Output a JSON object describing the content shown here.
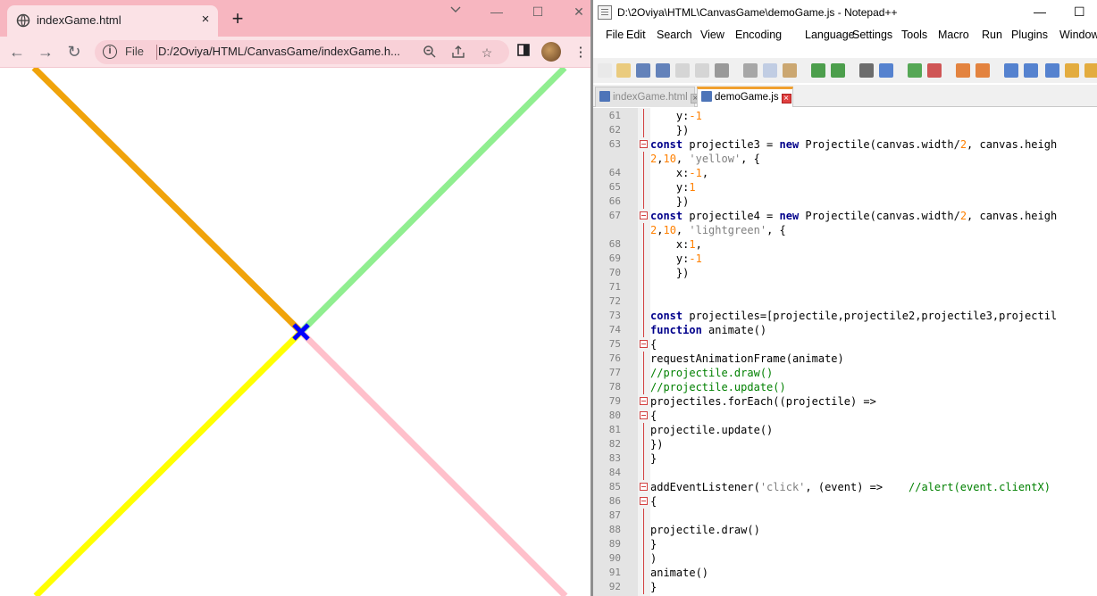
{
  "chrome": {
    "tab_title": "indexGame.html",
    "tab_close": "×",
    "new_tab": "+",
    "win_minimize": "—",
    "win_maximize": "☐",
    "win_close": "✕",
    "scheme": "File",
    "url": "D:/2Oviya/HTML/CanvasGame/indexGame.h..."
  },
  "canvas_colors": {
    "top_left": "#f0a30a",
    "top_right": "#90ee90",
    "bottom_left": "#ffff00",
    "bottom_right": "#ffc0cb",
    "player": "#0000ff"
  },
  "npp": {
    "title": "D:\\2Oviya\\HTML\\CanvasGame\\demoGame.js - Notepad++",
    "win_minimize": "—",
    "win_maximize": "☐",
    "menu": [
      "File",
      "Edit",
      "Search",
      "View",
      "Encoding",
      "Language",
      "Settings",
      "Tools",
      "Macro",
      "Run",
      "Plugins",
      "Window"
    ],
    "tabs": [
      {
        "label": "indexGame.html",
        "active": false
      },
      {
        "label": "demoGame.js",
        "active": true
      }
    ],
    "lines": [
      {
        "n": "61",
        "text": "    y:-1"
      },
      {
        "n": "62",
        "text": "    })"
      },
      {
        "n": "63",
        "text": "const projectile3 = new Projectile(canvas.width/2, canvas.heigh"
      },
      {
        "n": "",
        "text": "2,10, 'yellow', {"
      },
      {
        "n": "64",
        "text": "    x:-1,"
      },
      {
        "n": "65",
        "text": "    y:1"
      },
      {
        "n": "66",
        "text": "    })"
      },
      {
        "n": "67",
        "text": "const projectile4 = new Projectile(canvas.width/2, canvas.heigh"
      },
      {
        "n": "",
        "text": "2,10, 'lightgreen', {"
      },
      {
        "n": "68",
        "text": "    x:1,"
      },
      {
        "n": "69",
        "text": "    y:-1"
      },
      {
        "n": "70",
        "text": "    })"
      },
      {
        "n": "71",
        "text": ""
      },
      {
        "n": "72",
        "text": ""
      },
      {
        "n": "73",
        "text": "const projectiles=[projectile,projectile2,projectile3,projectil"
      },
      {
        "n": "74",
        "text": "function animate()"
      },
      {
        "n": "75",
        "text": "{"
      },
      {
        "n": "76",
        "text": "requestAnimationFrame(animate)"
      },
      {
        "n": "77",
        "text": "//projectile.draw()"
      },
      {
        "n": "78",
        "text": "//projectile.update()"
      },
      {
        "n": "79",
        "text": "projectiles.forEach((projectile) =>"
      },
      {
        "n": "80",
        "text": "{"
      },
      {
        "n": "81",
        "text": "projectile.update()"
      },
      {
        "n": "82",
        "text": "})"
      },
      {
        "n": "83",
        "text": "}"
      },
      {
        "n": "84",
        "text": ""
      },
      {
        "n": "85",
        "text": "addEventListener('click', (event) =>    //alert(event.clientX)"
      },
      {
        "n": "86",
        "text": "{"
      },
      {
        "n": "87",
        "text": ""
      },
      {
        "n": "88",
        "text": "projectile.draw()"
      },
      {
        "n": "89",
        "text": "}"
      },
      {
        "n": "90",
        "text": ")"
      },
      {
        "n": "91",
        "text": "animate()"
      },
      {
        "n": "92",
        "text": "}"
      }
    ]
  }
}
